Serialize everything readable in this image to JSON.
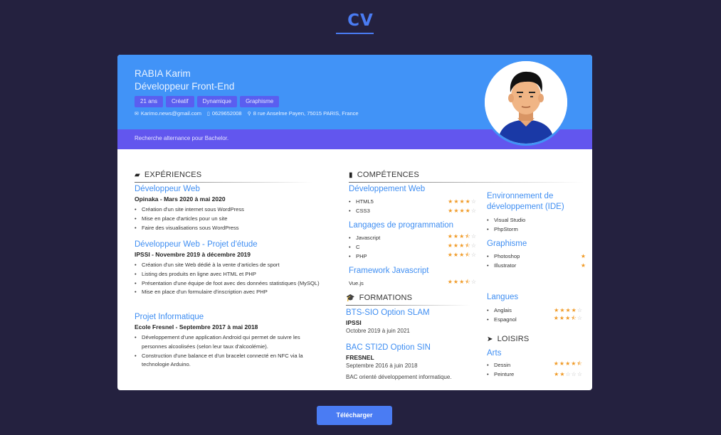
{
  "page": {
    "heading": "CV",
    "download_label": "Télécharger"
  },
  "profile": {
    "name": "RABIA Karim",
    "role": "Développeur Front-End",
    "tags": [
      "21 ans",
      "Créatif",
      "Dynamique",
      "Graphisme"
    ],
    "email": "Karimo.news@gmail.com",
    "phone": "0629652008",
    "address": "8 rue Anselme Payen, 75015 PARIS, France",
    "banner": "Recherche alternance pour Bachelor."
  },
  "experiences": {
    "title": "EXPÉRIENCES",
    "items": [
      {
        "title": "Développeur Web",
        "company": "Opinaka - Mars 2020 à mai 2020",
        "bullets": [
          "Création d'un site internet sous WordPress",
          "Mise en place d'articles pour un site",
          "Faire des visualisations sous WordPress"
        ]
      },
      {
        "title": "Développeur Web - Projet d'étude",
        "company": "IPSSI - Novembre 2019 à décembre 2019",
        "bullets": [
          "Création d'un site Web dédié à la vente d'articles de sport",
          "Listing des produits en ligne avec HTML et PHP",
          "Présentation d'une équipe de foot avec des données statistiques (MySQL)",
          "Mise en place d'un formulaire d'inscription avec PHP"
        ]
      },
      {
        "title": "Projet Informatique",
        "company": "Ecole Fresnel - Septembre 2017 à mai 2018",
        "bullets": [
          "Développement d'une application Android qui permet de suivre les personnes alcoolisées (selon leur taux d'alcoolémie).",
          "Construction d'une balance et d'un bracelet connecté en NFC via la technologie Arduino."
        ]
      }
    ]
  },
  "skills": {
    "title": "COMPÉTENCES",
    "web": {
      "title": "Développement Web",
      "items": [
        {
          "label": "HTML5",
          "rating": 4
        },
        {
          "label": "CSS3",
          "rating": 4
        }
      ]
    },
    "languages_prog": {
      "title": "Langages de programmation",
      "items": [
        {
          "label": "Javascript",
          "rating": 3.5
        },
        {
          "label": "C",
          "rating": 3.5
        },
        {
          "label": "PHP",
          "rating": 3.5
        }
      ]
    },
    "framework": {
      "title": "Framework Javascript",
      "items": [
        {
          "label": "Vue.js",
          "rating": 3.5
        }
      ]
    },
    "ide": {
      "title_line1": "Environnement de",
      "title_line2": "développement (IDE)",
      "items": [
        "Visual Studio",
        "PhpStorm"
      ]
    },
    "graphics": {
      "title": "Graphisme",
      "items": [
        {
          "label": "Photoshop",
          "rating": 1
        },
        {
          "label": "Illustrator",
          "rating": 1
        }
      ]
    },
    "langs": {
      "title": "Langues",
      "items": [
        {
          "label": "Anglais",
          "rating": 4
        },
        {
          "label": "Espagnol",
          "rating": 3.5
        }
      ]
    }
  },
  "formations": {
    "title": "FORMATIONS",
    "items": [
      {
        "title": "BTS-SIO Option SLAM",
        "school": "IPSSI",
        "date": "Octobre 2019 à juin 2021"
      },
      {
        "title": "BAC STI2D Option SIN",
        "school": "FRESNEL",
        "date": "Septembre 2016 à juin 2018",
        "note": "BAC orienté développement informatique."
      }
    ]
  },
  "hobbies": {
    "title": "LOISIRS",
    "subtitle": "Arts",
    "items": [
      {
        "label": "Dessin",
        "rating": 4.5
      },
      {
        "label": "Peinture",
        "rating": 2
      }
    ]
  },
  "colors": {
    "accent": "#4193f7",
    "banner": "#6256ee",
    "background": "#24213f",
    "star": "#f09a26"
  },
  "icons": {
    "email": "mail-icon",
    "phone": "phone-icon",
    "address": "pin-icon",
    "experience": "briefcase-icon",
    "skills": "clipboard-icon",
    "formations": "graduation-cap-icon",
    "hobbies": "paper-plane-icon"
  }
}
